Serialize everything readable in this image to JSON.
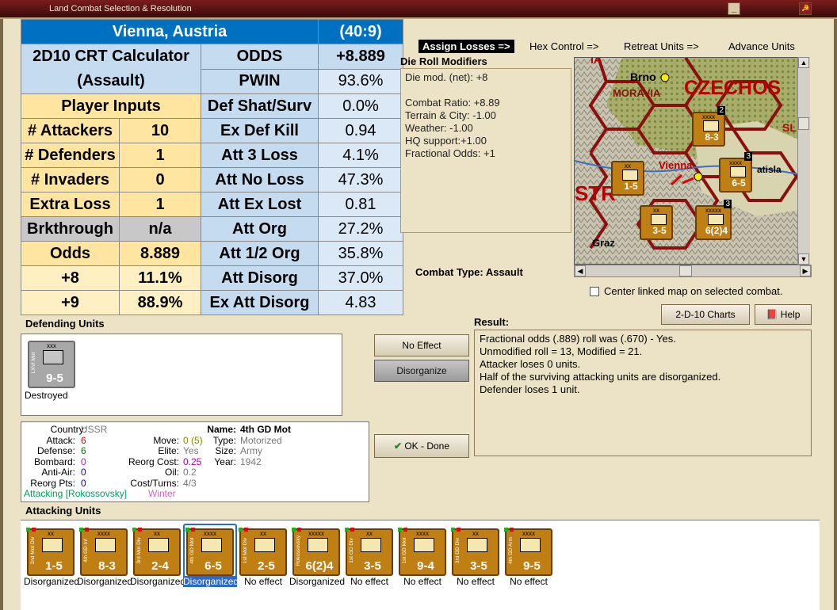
{
  "window": {
    "title": "Land Combat Selection & Resolution"
  },
  "crt": {
    "location": "Vienna, Austria",
    "coords": "(40:9)",
    "calc_title_1": "2D10 CRT Calculator",
    "calc_title_2": "(Assault)",
    "player_inputs": "Player Inputs",
    "rows": [
      {
        "label": "ODDS",
        "value": "+8.889"
      },
      {
        "label": "PWIN",
        "value": "93.6%"
      },
      {
        "label": "Def Shat/Surv",
        "value": "0.0%"
      },
      {
        "label": "Ex Def Kill",
        "value": "0.94"
      },
      {
        "label": "Att 3 Loss",
        "value": "4.1%"
      },
      {
        "label": "Att No Loss",
        "value": "47.3%"
      },
      {
        "label": "Att Ex Lost",
        "value": "0.81"
      },
      {
        "label": "Att Org",
        "value": "27.2%"
      },
      {
        "label": "Att 1/2 Org",
        "value": "35.8%"
      },
      {
        "label": "Att Disorg",
        "value": "37.0%"
      },
      {
        "label": "Ex Att Disorg",
        "value": "4.83"
      }
    ],
    "inputs": [
      {
        "label": "# Attackers",
        "value": "10"
      },
      {
        "label": "# Defenders",
        "value": "1"
      },
      {
        "label": "# Invaders",
        "value": "0"
      },
      {
        "label": "Extra Loss",
        "value": "1"
      },
      {
        "label": "Brkthrough",
        "value": "n/a"
      },
      {
        "label": "Odds",
        "value": "8.889"
      },
      {
        "label": "+8",
        "value": "11.1%"
      },
      {
        "label": "+9",
        "value": "88.9%"
      }
    ]
  },
  "actions": {
    "assign": "Assign Losses =>",
    "hex": "Hex Control =>",
    "retreat": "Retreat Units =>",
    "advance": "Advance Units"
  },
  "modifiers": {
    "title": "Die Roll Modifiers",
    "lines": [
      "Die mod. (net): +8",
      "",
      "Combat Ratio: +8.89",
      "Terrain & City: -1.00",
      "Weather: -1.00",
      "HQ support:+1.00",
      "Fractional Odds: +1"
    ]
  },
  "map": {
    "labels": {
      "brno": "Brno",
      "moravia": "MORAVIA",
      "czech": "CZECHOS",
      "vienna": "Vienna",
      "bratislava": "atisla",
      "graz": "Graz",
      "str": "STR",
      "sl": "SL",
      "ia": "IA"
    },
    "counters": [
      {
        "size": "xxxx",
        "str": "8-3",
        "tag": "4th GD Inf",
        "badge": "2"
      },
      {
        "size": "xx",
        "str": "1-5",
        "tag": "2nd Mot Div",
        "badge": ""
      },
      {
        "size": "xxxx",
        "str": "6-5",
        "tag": "4th GD Mot",
        "badge": "3"
      },
      {
        "size": "xx",
        "str": "3-5",
        "tag": "3rd GD Div",
        "badge": ""
      },
      {
        "size": "xxxxx",
        "str": "6(2)4",
        "tag": "Rokossovsky",
        "badge": "3"
      }
    ]
  },
  "combat_type": "Combat Type:  Assault",
  "center_map_label": "Center linked map on selected combat.",
  "buttons": {
    "charts": "2-D-10 Charts",
    "help": "Help",
    "no_effect": "No Effect",
    "disorganize": "Disorganize",
    "ok": "OK - Done"
  },
  "result": {
    "label": "Result:",
    "lines": [
      "Fractional odds (.889) roll was (.670)  - Yes.",
      "Unmodified roll = 13, Modified = 21.",
      "Attacker loses 0 units.",
      "Half of the surviving attacking units are disorganized.",
      "Defender loses 1 unit."
    ]
  },
  "defending": {
    "label": "Defending Units",
    "units": [
      {
        "size": "xxx",
        "str": "9-5",
        "tag": "LXVI Mot",
        "status": "Destroyed"
      }
    ]
  },
  "info": {
    "country_label": "Country:",
    "country": "USSR",
    "attack_label": "Attack:",
    "attack": "6",
    "defense_label": "Defense:",
    "defense": "6",
    "bombard_label": "Bombard:",
    "bombard": "0",
    "antiair_label": "Anti-Air:",
    "antiair": "0",
    "reorg_label": "Reorg Pts:",
    "reorg": "0",
    "attacking_text": "Attacking [Rokossovsky]",
    "season": "Winter",
    "move_label": "Move:",
    "move": "0 (5)",
    "elite_label": "Elite:",
    "elite": "Yes",
    "reorgcost_label": "Reorg Cost:",
    "reorgcost": "0.25",
    "oil_label": "Oil:",
    "oil": "0.2",
    "costturns_label": "Cost/Turns:",
    "costturns": "4/3",
    "name_label": "Name:",
    "name": "4th GD Mot",
    "type_label": "Type:",
    "type": "Motorized",
    "size_label": "Size:",
    "size": "Army",
    "year_label": "Year:",
    "year": "1942"
  },
  "attacking": {
    "label": "Attacking Units",
    "units": [
      {
        "size": "xx",
        "str": "1-5",
        "tag": "2nd Mot Div",
        "status": "Disorganized",
        "selected": false
      },
      {
        "size": "xxxx",
        "str": "8-3",
        "tag": "4th GD Inf",
        "status": "Disorganized",
        "selected": false
      },
      {
        "size": "xx",
        "str": "2-4",
        "tag": "3rd Mot Div",
        "status": "Disorganized",
        "selected": false
      },
      {
        "size": "xxxx",
        "str": "6-5",
        "tag": "4th GD Mot",
        "status": "Disorganized",
        "selected": true
      },
      {
        "size": "xx",
        "str": "2-5",
        "tag": "1st Mot Div",
        "status": "No effect",
        "selected": false
      },
      {
        "size": "xxxxx",
        "str": "6(2)4",
        "tag": "Rokossovsky",
        "status": "Disorganized",
        "selected": false
      },
      {
        "size": "xx",
        "str": "3-5",
        "tag": "1st GD Div",
        "status": "No effect",
        "selected": false
      },
      {
        "size": "xxxx",
        "str": "9-4",
        "tag": "1st GD Mot",
        "status": "No effect",
        "selected": false
      },
      {
        "size": "xx",
        "str": "3-5",
        "tag": "3rd GD Div",
        "status": "No effect",
        "selected": false
      },
      {
        "size": "xxxx",
        "str": "9-5",
        "tag": "4th GD Arm",
        "status": "No effect",
        "selected": false
      }
    ]
  },
  "colors": {
    "accent": "#0070c0",
    "counter": "#bf7f12",
    "attack": "#e00000",
    "defense": "#008000",
    "attacking_text": "#00a060",
    "season": "#d060d0"
  }
}
